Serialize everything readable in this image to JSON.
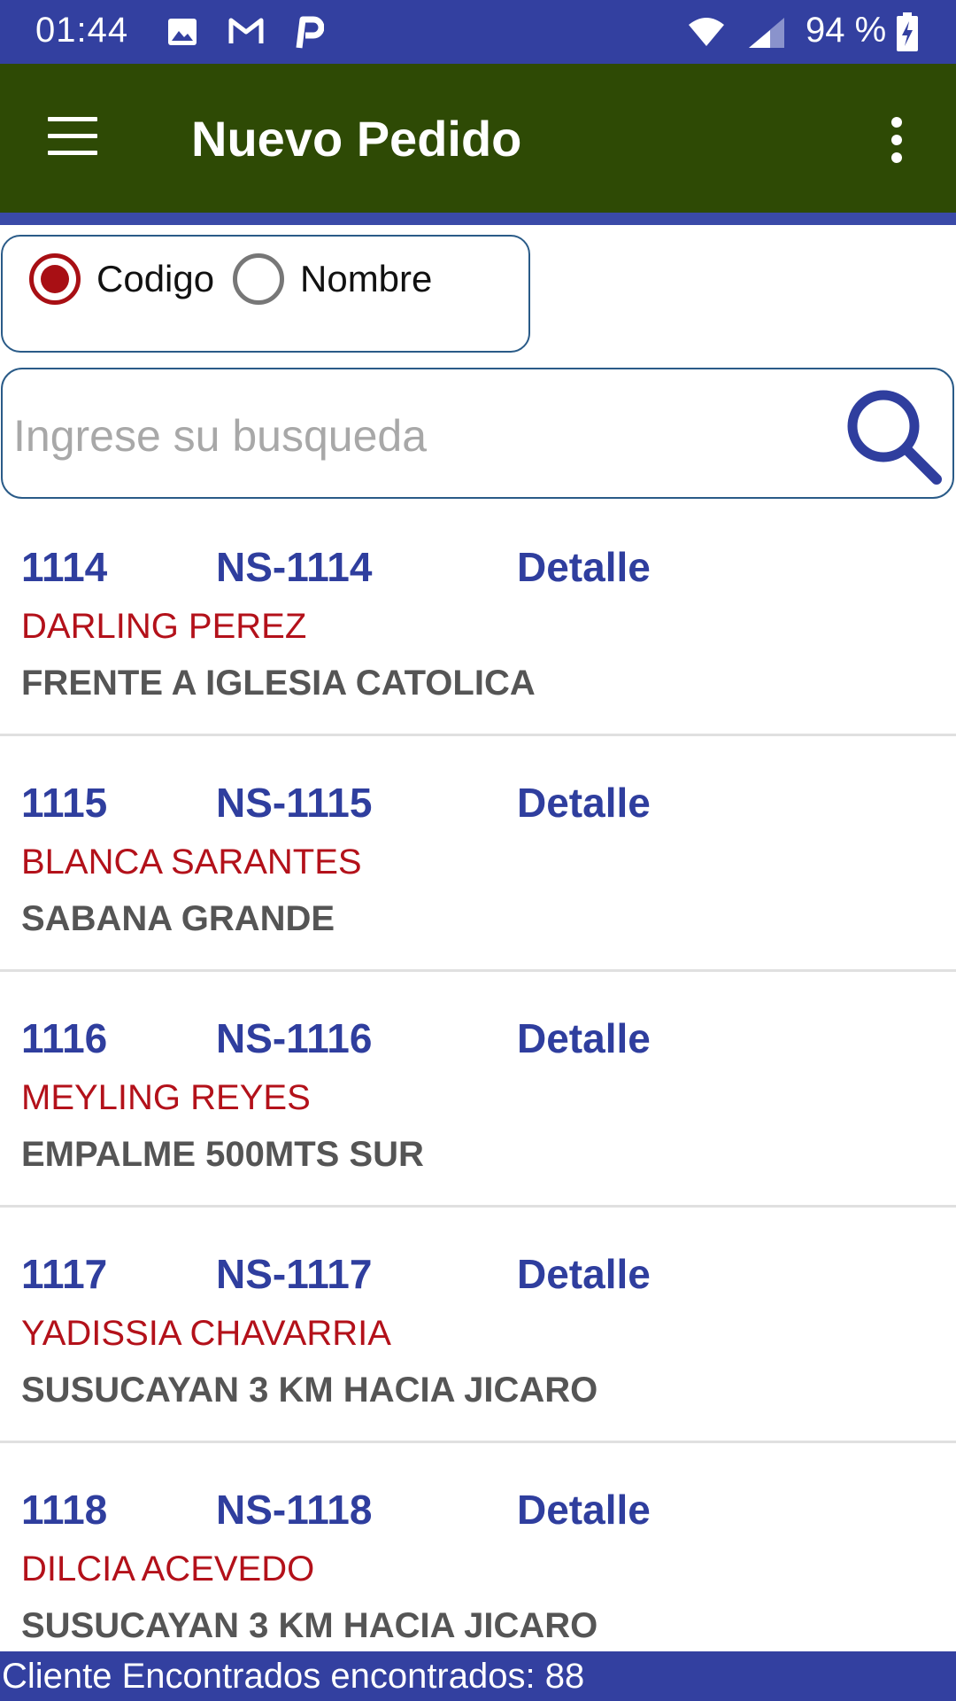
{
  "status_bar": {
    "time": "01:44",
    "battery": "94 %",
    "icons": [
      "image-icon",
      "gmail-icon",
      "p-app-icon",
      "wifi-icon",
      "signal-icon",
      "battery-charging-icon"
    ]
  },
  "app_bar": {
    "title": "Nuevo Pedido",
    "menu_icon": "hamburger-menu-icon",
    "overflow_icon": "more-vert-icon",
    "color": "#2e4a05"
  },
  "search_mode": {
    "options": [
      {
        "label": "Codigo",
        "selected": true
      },
      {
        "label": "Nombre",
        "selected": false
      }
    ]
  },
  "search": {
    "placeholder": "Ingrese su busqueda",
    "value": "",
    "icon": "search-icon"
  },
  "clients": [
    {
      "code": "1114",
      "ref": "NS-1114",
      "detail_label": "Detalle",
      "name": "DARLING PEREZ",
      "address": "FRENTE A IGLESIA CATOLICA"
    },
    {
      "code": "1115",
      "ref": "NS-1115",
      "detail_label": "Detalle",
      "name": "BLANCA SARANTES",
      "address": "SABANA GRANDE"
    },
    {
      "code": "1116",
      "ref": "NS-1116",
      "detail_label": "Detalle",
      "name": "MEYLING REYES",
      "address": "EMPALME 500MTS SUR"
    },
    {
      "code": "1117",
      "ref": "NS-1117",
      "detail_label": "Detalle",
      "name": "YADISSIA CHAVARRIA",
      "address": "SUSUCAYAN 3 KM HACIA JICARO"
    },
    {
      "code": "1118",
      "ref": "NS-1118",
      "detail_label": "Detalle",
      "name": "DILCIA ACEVEDO",
      "address": "SUSUCAYAN 3 KM HACIA JICARO"
    }
  ],
  "footer": {
    "text": "Cliente Encontrados encontrados: 88"
  },
  "colors": {
    "primary": "#3340a0",
    "code_text": "#2f3e9e",
    "name_text": "#b3111a",
    "address_text": "#555555"
  }
}
